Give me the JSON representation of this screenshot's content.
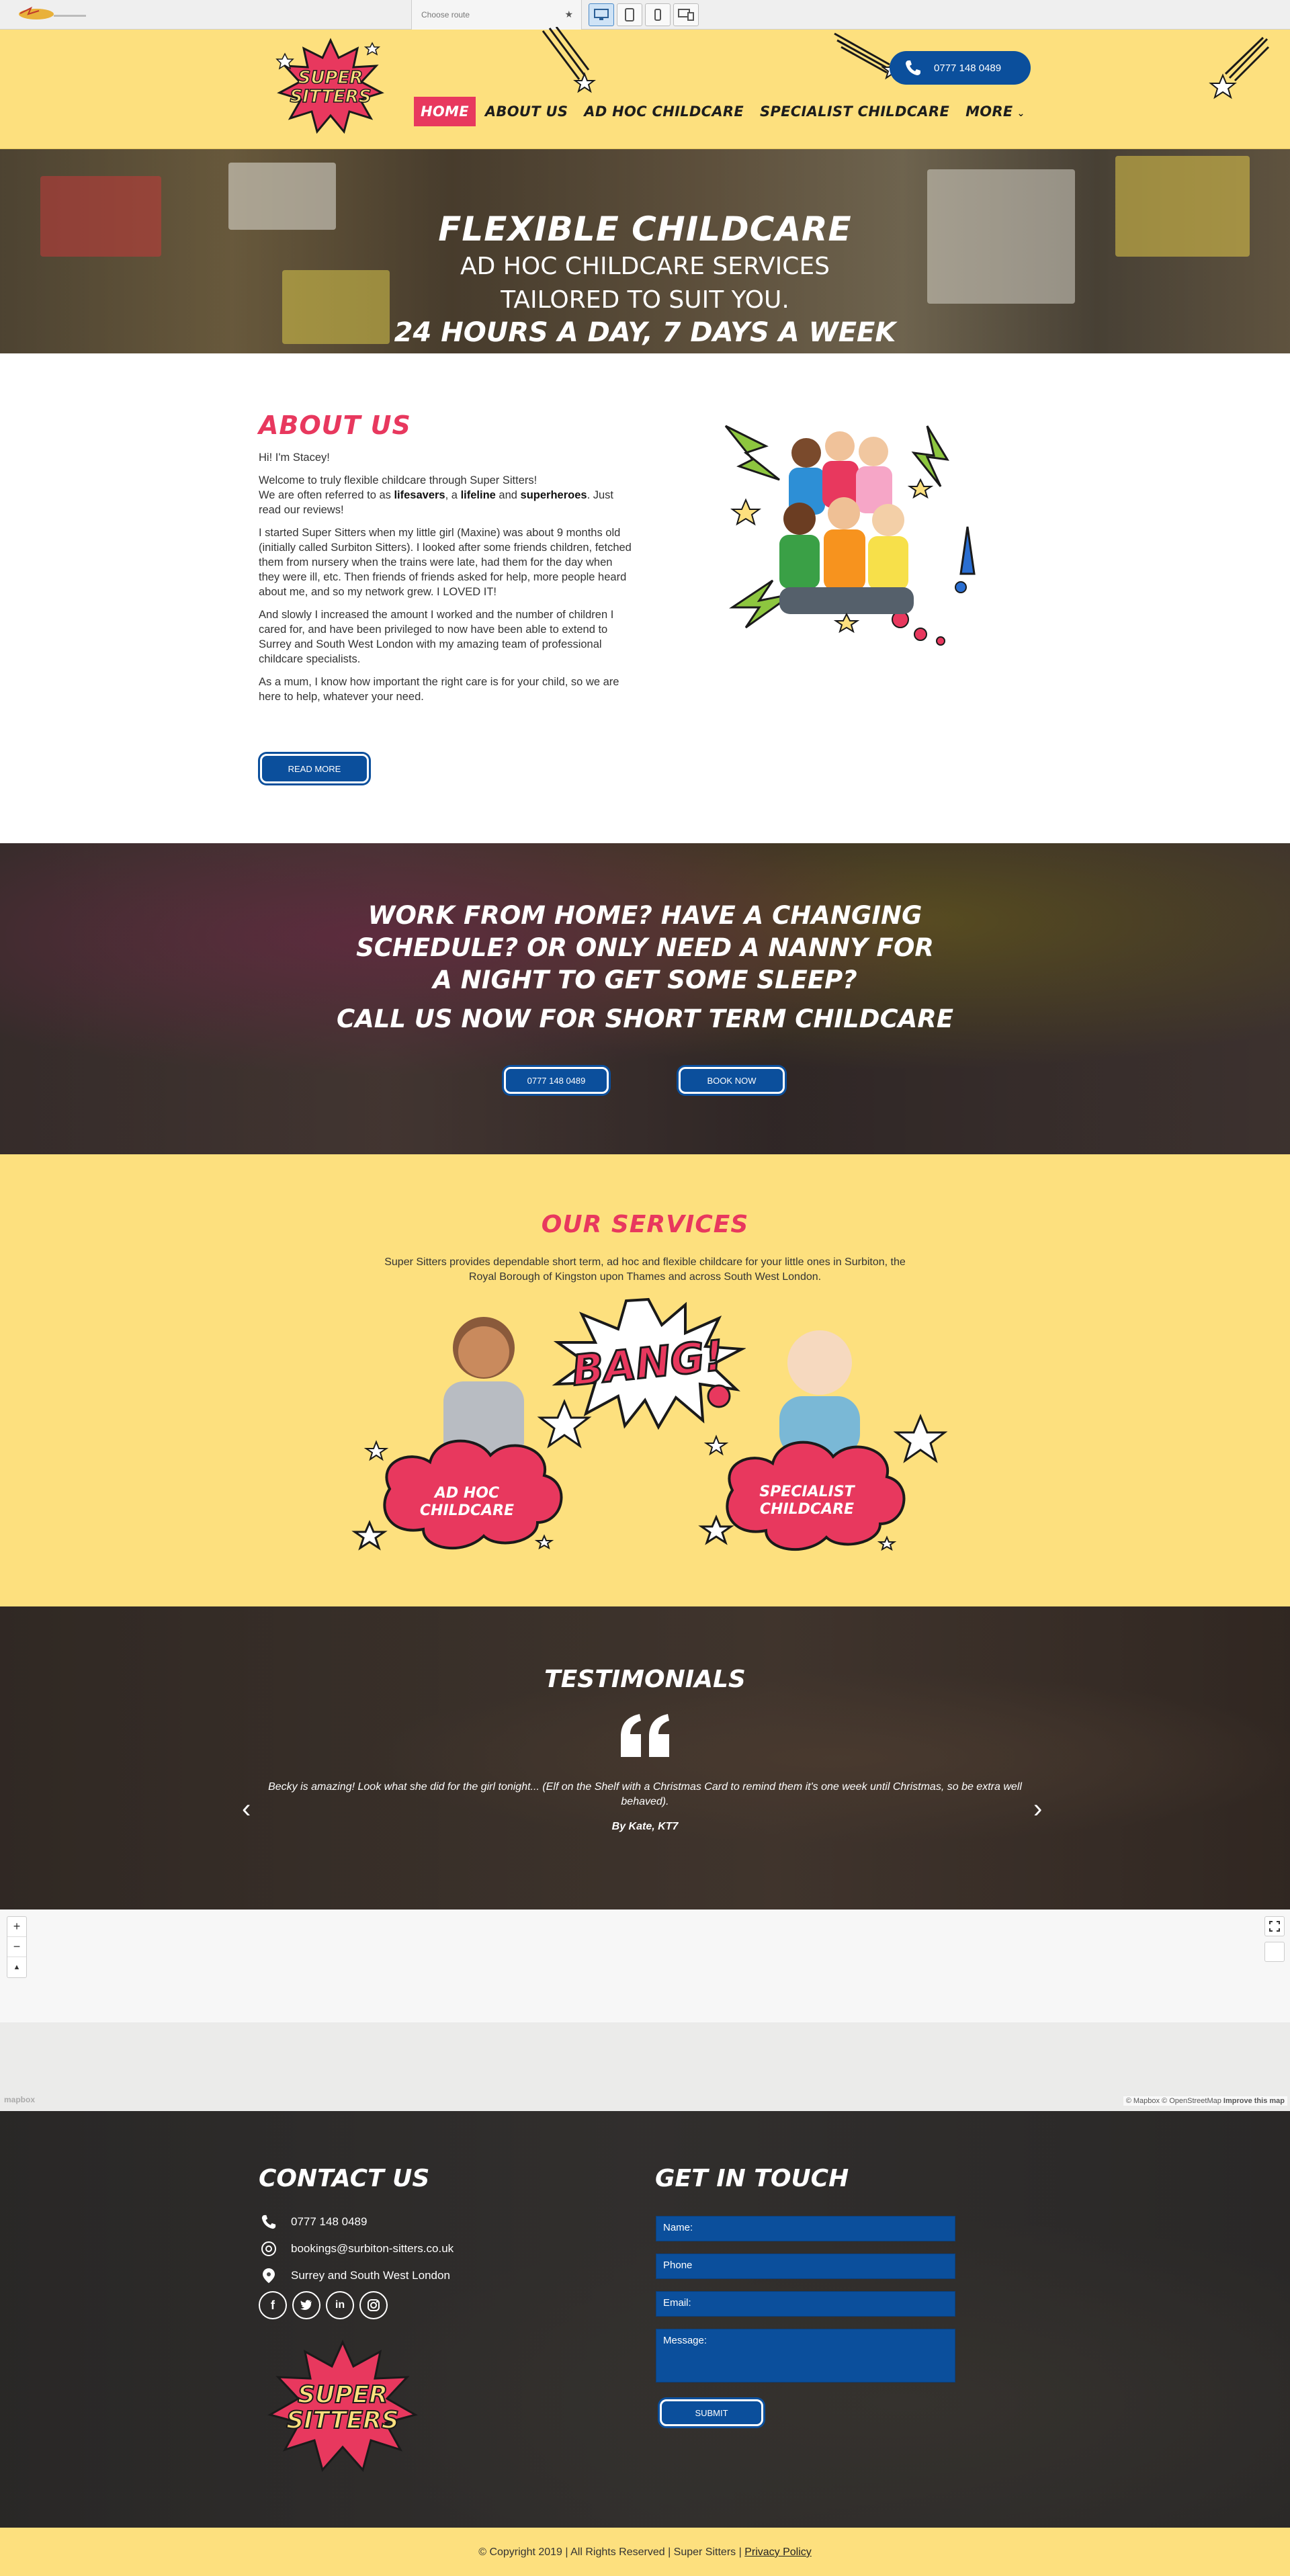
{
  "toolbar": {
    "select_placeholder": "Choose route",
    "devices": [
      "desktop-icon",
      "tablet-icon",
      "mobile-icon",
      "responsive-icon"
    ]
  },
  "header": {
    "logo_text_1": "SUPER",
    "logo_text_2": "SITTERS",
    "nav": [
      {
        "label": "HOME",
        "active": true
      },
      {
        "label": "ABOUT US",
        "active": false
      },
      {
        "label": "AD HOC CHILDCARE",
        "active": false
      },
      {
        "label": "SPECIALIST CHILDCARE",
        "active": false
      },
      {
        "label": "MORE",
        "active": false
      }
    ],
    "phone": "0777 148 0489"
  },
  "hero": {
    "line1": "FLEXIBLE CHILDCARE",
    "line2": "AD HOC CHILDCARE SERVICES",
    "line3": "TAILORED TO SUIT YOU.",
    "line4": "24 HOURS A DAY, 7 DAYS A WEEK"
  },
  "about": {
    "title": "ABOUT US",
    "greeting": "Hi! I'm Stacey!",
    "p1a": "Welcome to truly flexible childcare through Super Sitters!",
    "p1b_pre": "We are often referred to as ",
    "p1b_lifesavers": "lifesavers",
    "p1b_mid": ", a ",
    "p1b_lifeline": "lifeline",
    "p1b_and": " and ",
    "p1b_superheroes": "superheroes",
    "p1b_post": ". Just read our reviews!",
    "p2": "I started Super Sitters when my little girl (Maxine) was about 9 months old (initially called Surbiton Sitters). I looked after some friends children, fetched them from nursery when the trains were late, had them for the day when they were ill, etc. Then friends of friends asked for help, more people heard about me, and so my network grew. I LOVED IT!",
    "p3": "And slowly I increased the amount I worked and the number of children I cared for, and have been privileged to now have been able to extend to Surrey and South West London with my amazing team of professional childcare specialists.",
    "p4": "As a mum, I know how important the right care is for your child, so we are here to help, whatever your need.",
    "button": "READ MORE"
  },
  "cta": {
    "question": "WORK FROM HOME? HAVE A CHANGING SCHEDULE? OR ONLY NEED A NANNY FOR A NIGHT TO GET SOME SLEEP?",
    "call": "CALL US NOW FOR SHORT TERM CHILDCARE",
    "phone_button": "0777 148 0489",
    "book_button": "BOOK NOW"
  },
  "services": {
    "title": "OUR SERVICES",
    "intro": "Super Sitters provides dependable short term, ad hoc and flexible childcare for your little ones in Surbiton, the Royal Borough of Kingston upon Thames and across South West London.",
    "bang": "BANG!",
    "items": [
      {
        "line1": "AD HOC",
        "line2": "CHILDCARE"
      },
      {
        "line1": "SPECIALIST",
        "line2": "CHILDCARE"
      }
    ]
  },
  "testimonials": {
    "title": "TESTIMONIALS",
    "quote": "Becky is amazing! Look what she did for the girl tonight... (Elf on the Shelf with a Christmas Card to remind them it's one week until Christmas, so be extra well behaved).",
    "author": "By Kate, KT7"
  },
  "map": {
    "zoom_in": "+",
    "zoom_out": "−",
    "compass": "▲",
    "mapbox": "mapbox",
    "attribution": "© Mapbox © OpenStreetMap",
    "improve": "Improve this map"
  },
  "footer": {
    "contact_title": "CONTACT US",
    "phone": "0777 148 0489",
    "email": "bookings@surbiton-sitters.co.uk",
    "area": "Surrey and South West London",
    "social": [
      "facebook-icon",
      "twitter-icon",
      "linkedin-icon",
      "instagram-icon"
    ],
    "form_title": "GET IN TOUCH",
    "name_placeholder": "Name:",
    "phone_placeholder": "Phone",
    "email_placeholder": "Email:",
    "message_placeholder": "Message:",
    "submit": "SUBMIT",
    "copyright": "© Copyright 2019 | All Rights Reserved | Super Sitters | ",
    "privacy": "Privacy Policy"
  },
  "colors": {
    "yellow": "#fde07e",
    "pink": "#e8385e",
    "blue": "#0b4f9c"
  }
}
